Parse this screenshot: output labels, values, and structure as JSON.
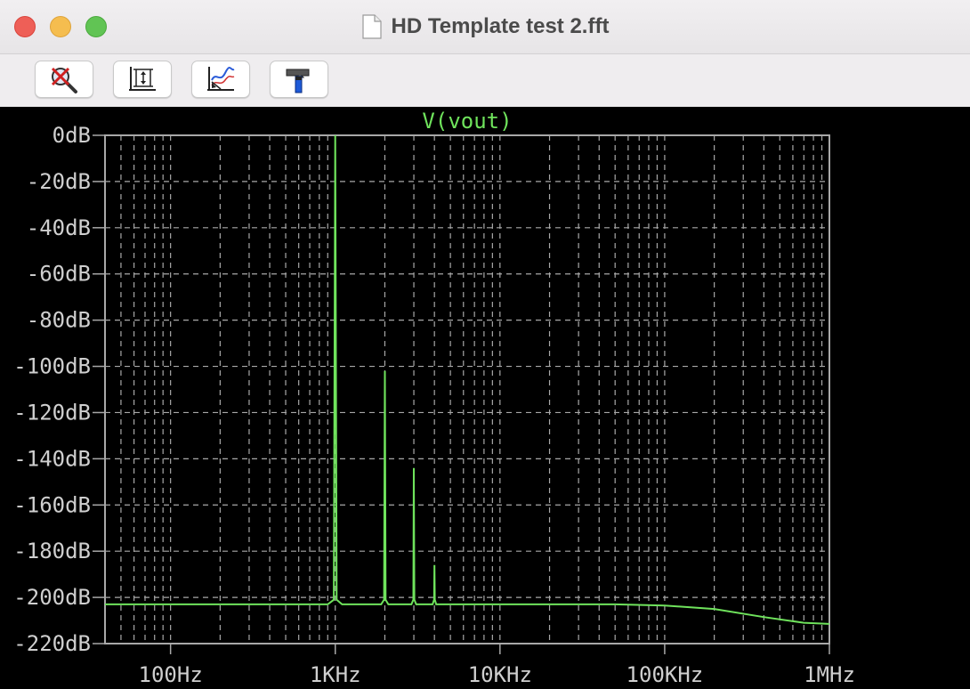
{
  "window": {
    "title": "HD Template test 2.fft"
  },
  "toolbar": {
    "buttons": [
      {
        "name": "zoom-cancel-button",
        "icon": "zoom-cancel-icon"
      },
      {
        "name": "autorange-button",
        "icon": "autorange-icon"
      },
      {
        "name": "axes-button",
        "icon": "axes-icon"
      },
      {
        "name": "settings-button",
        "icon": "hammer-icon"
      }
    ]
  },
  "colors": {
    "trace": "#6fe35c",
    "grid": "#a8a8a8",
    "axis_text": "#cfcfcf",
    "background": "#000000"
  },
  "chart_data": {
    "type": "line",
    "title": "V(vout)",
    "xscale": "log",
    "xlim": [
      40,
      1000000
    ],
    "ylim": [
      -220,
      0
    ],
    "x_ticks": [
      {
        "value": 100,
        "label": "100Hz"
      },
      {
        "value": 1000,
        "label": "1KHz"
      },
      {
        "value": 10000,
        "label": "10KHz"
      },
      {
        "value": 100000,
        "label": "100KHz"
      },
      {
        "value": 1000000,
        "label": "1MHz"
      }
    ],
    "y_ticks": [
      {
        "value": 0,
        "label": "0dB"
      },
      {
        "value": -20,
        "label": "-20dB"
      },
      {
        "value": -40,
        "label": "-40dB"
      },
      {
        "value": -60,
        "label": "-60dB"
      },
      {
        "value": -80,
        "label": "-80dB"
      },
      {
        "value": -100,
        "label": "-100dB"
      },
      {
        "value": -120,
        "label": "-120dB"
      },
      {
        "value": -140,
        "label": "-140dB"
      },
      {
        "value": -160,
        "label": "-160dB"
      },
      {
        "value": -180,
        "label": "-180dB"
      },
      {
        "value": -200,
        "label": "-200dB"
      },
      {
        "value": -220,
        "label": "-220dB"
      }
    ],
    "grid": true,
    "series": [
      {
        "name": "V(vout)",
        "x": [
          40,
          900,
          980,
          1000,
          1020,
          1100,
          1900,
          1980,
          2000,
          2020,
          2100,
          2900,
          2980,
          3000,
          3020,
          3100,
          3900,
          3980,
          4000,
          4020,
          4100,
          10000,
          50000,
          100000,
          200000,
          400000,
          700000,
          1000000
        ],
        "y": [
          -203,
          -203,
          -201,
          0,
          -201,
          -203,
          -203,
          -201,
          -102,
          -201,
          -203,
          -203,
          -201,
          -144,
          -201,
          -203,
          -203,
          -201,
          -186,
          -201,
          -203,
          -203,
          -203,
          -203.5,
          -205,
          -208.5,
          -211,
          -211.5
        ]
      }
    ]
  }
}
